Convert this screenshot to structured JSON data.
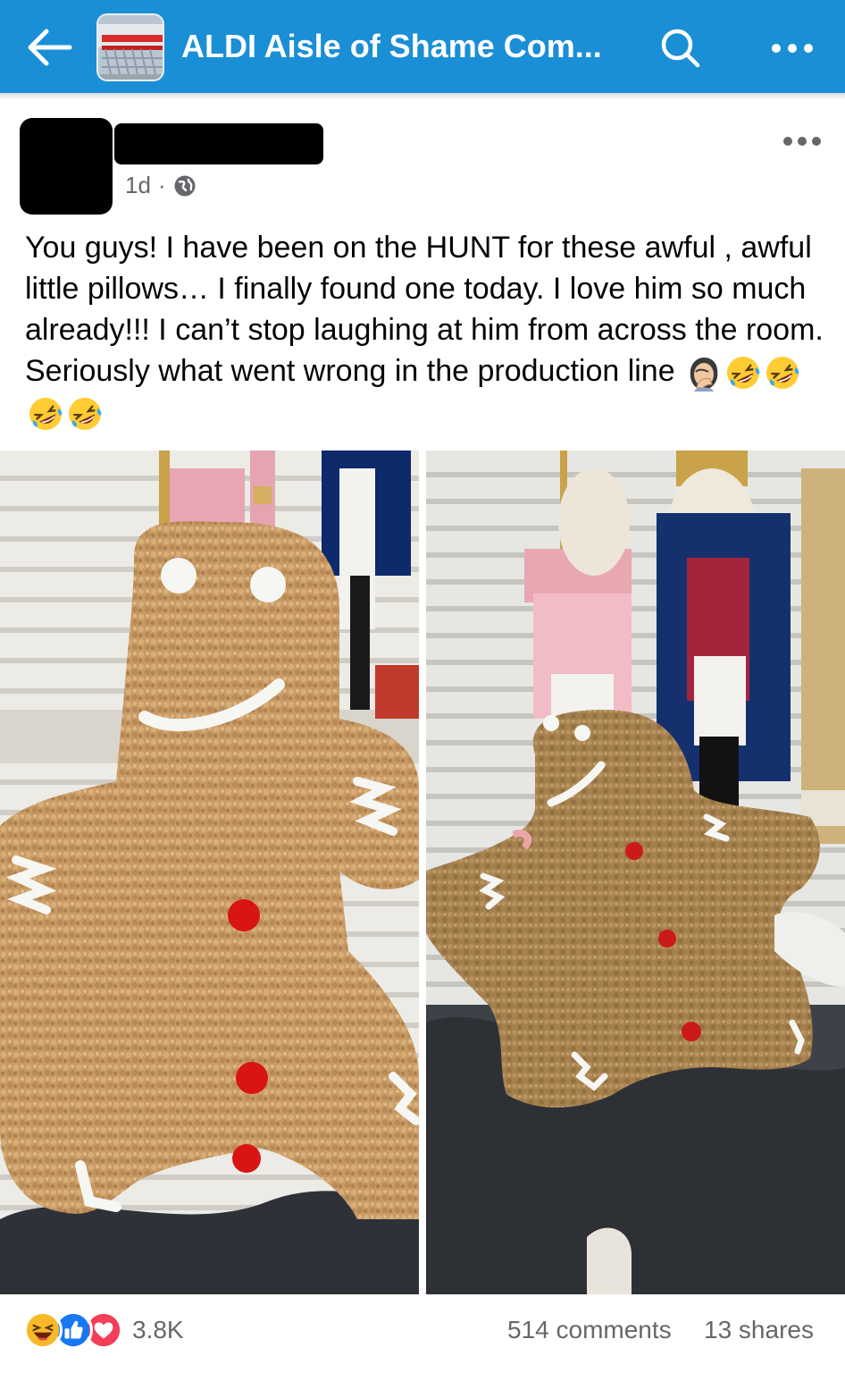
{
  "app_bar": {
    "back_icon": "arrow-left-icon",
    "group_title": "ALDI Aisle of Shame Com...",
    "search_icon": "search-icon",
    "menu_icon": "more-horizontal-icon",
    "bar_color": "#1a8fd6"
  },
  "post": {
    "timestamp": "1d",
    "separator": "·",
    "privacy_icon": "globe-icon",
    "menu_icon": "more-horizontal-icon",
    "text": "You guys! I have been on the HUNT for these awful , awful little pillows… I finally found one today. I love him so much already!!! I can’t stop laughing at him from across the room. Seriously what went wrong in the production line",
    "emojis": [
      "facepalm-woman-emoji",
      "rolling-laughing-emoji",
      "rolling-laughing-emoji",
      "rolling-laughing-emoji",
      "rolling-laughing-emoji"
    ]
  },
  "photos": [
    {
      "subject": "gingerbread-man-pillow-front",
      "description_icon": "gingerbread-pillow-photo"
    },
    {
      "subject": "gingerbread-man-pillow-tilted",
      "description_icon": "gingerbread-pillow-photo"
    }
  ],
  "footer": {
    "reaction_icons": [
      "haha-reaction-icon",
      "like-reaction-icon",
      "love-reaction-icon"
    ],
    "reaction_count": "3.8K",
    "comments": "514 comments",
    "shares": "13 shares",
    "muted_color": "#65676b"
  }
}
